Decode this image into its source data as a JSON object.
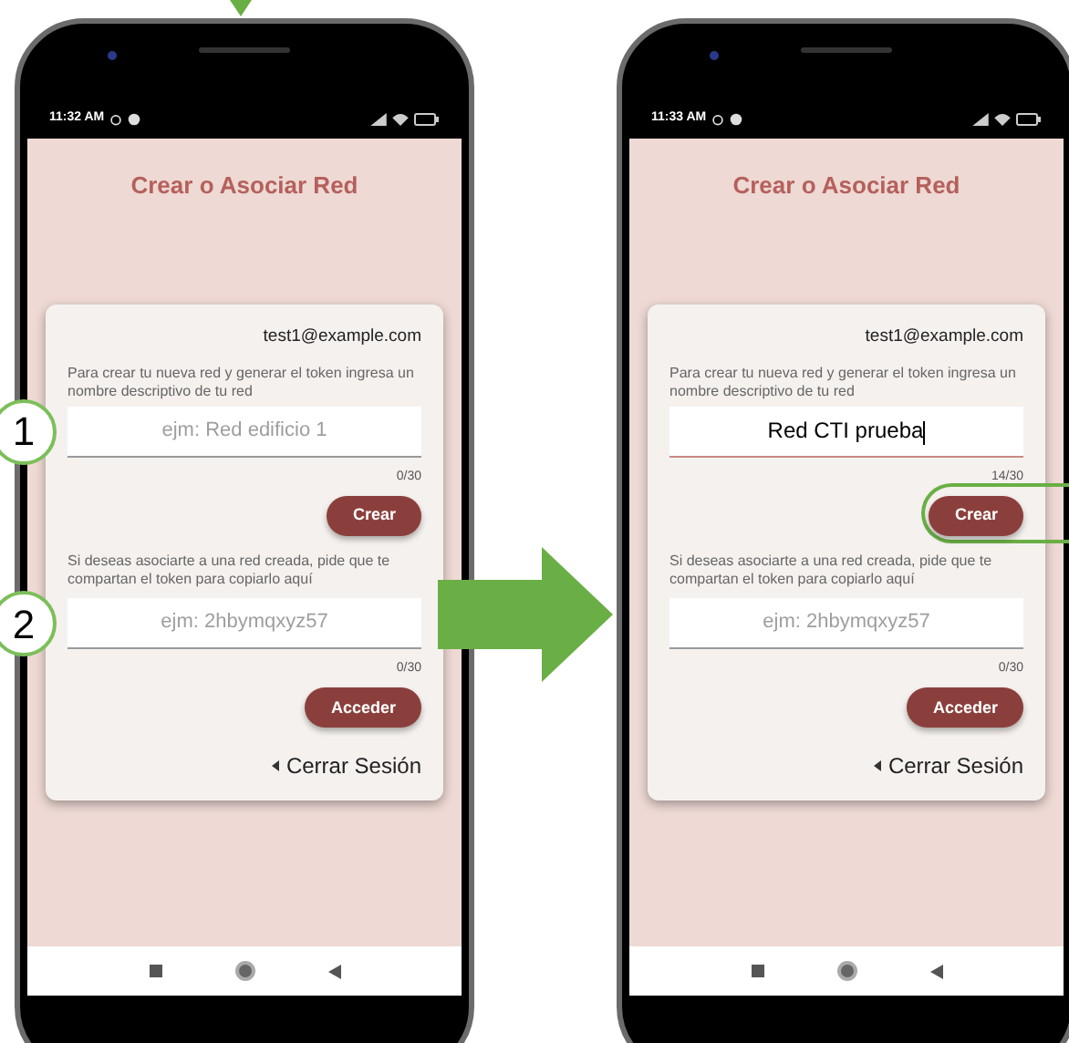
{
  "screens": [
    {
      "status_time": "11:32 AM",
      "title": "Crear o Asociar Red",
      "email": "test1@example.com",
      "create": {
        "instructions": "Para crear tu nueva red y generar el token ingresa un nombre descriptivo de tu red",
        "field": {
          "placeholder": "ejm: Red edificio 1",
          "focused": false,
          "callout": "1"
        },
        "counter": "0/30",
        "button": {
          "label": "Crear",
          "highlighted": false
        }
      },
      "join": {
        "instructions": "Si deseas asociarte a una red creada, pide que te compartan el token para copiarlo aquí",
        "field": {
          "placeholder": "ejm: 2hbymqxyz57",
          "focused": false,
          "callout": "2"
        },
        "counter": "0/30",
        "button": {
          "label": "Acceder",
          "highlighted": false
        }
      },
      "logout": "Cerrar Sesión"
    },
    {
      "status_time": "11:33 AM",
      "title": "Crear o Asociar Red",
      "email": "test1@example.com",
      "create": {
        "instructions": "Para crear tu nueva red y generar el token ingresa un nombre descriptivo de tu red",
        "field": {
          "value": "Red CTI prueba",
          "focused": true
        },
        "counter": "14/30",
        "button": {
          "label": "Crear",
          "highlighted": true
        }
      },
      "join": {
        "instructions": "Si deseas asociarte a una red creada, pide que te compartan el token para copiarlo aquí",
        "field": {
          "placeholder": "ejm: 2hbymqxyz57",
          "focused": false
        },
        "counter": "0/30",
        "button": {
          "label": "Acceder",
          "highlighted": false
        }
      },
      "logout": "Cerrar Sesión"
    }
  ]
}
